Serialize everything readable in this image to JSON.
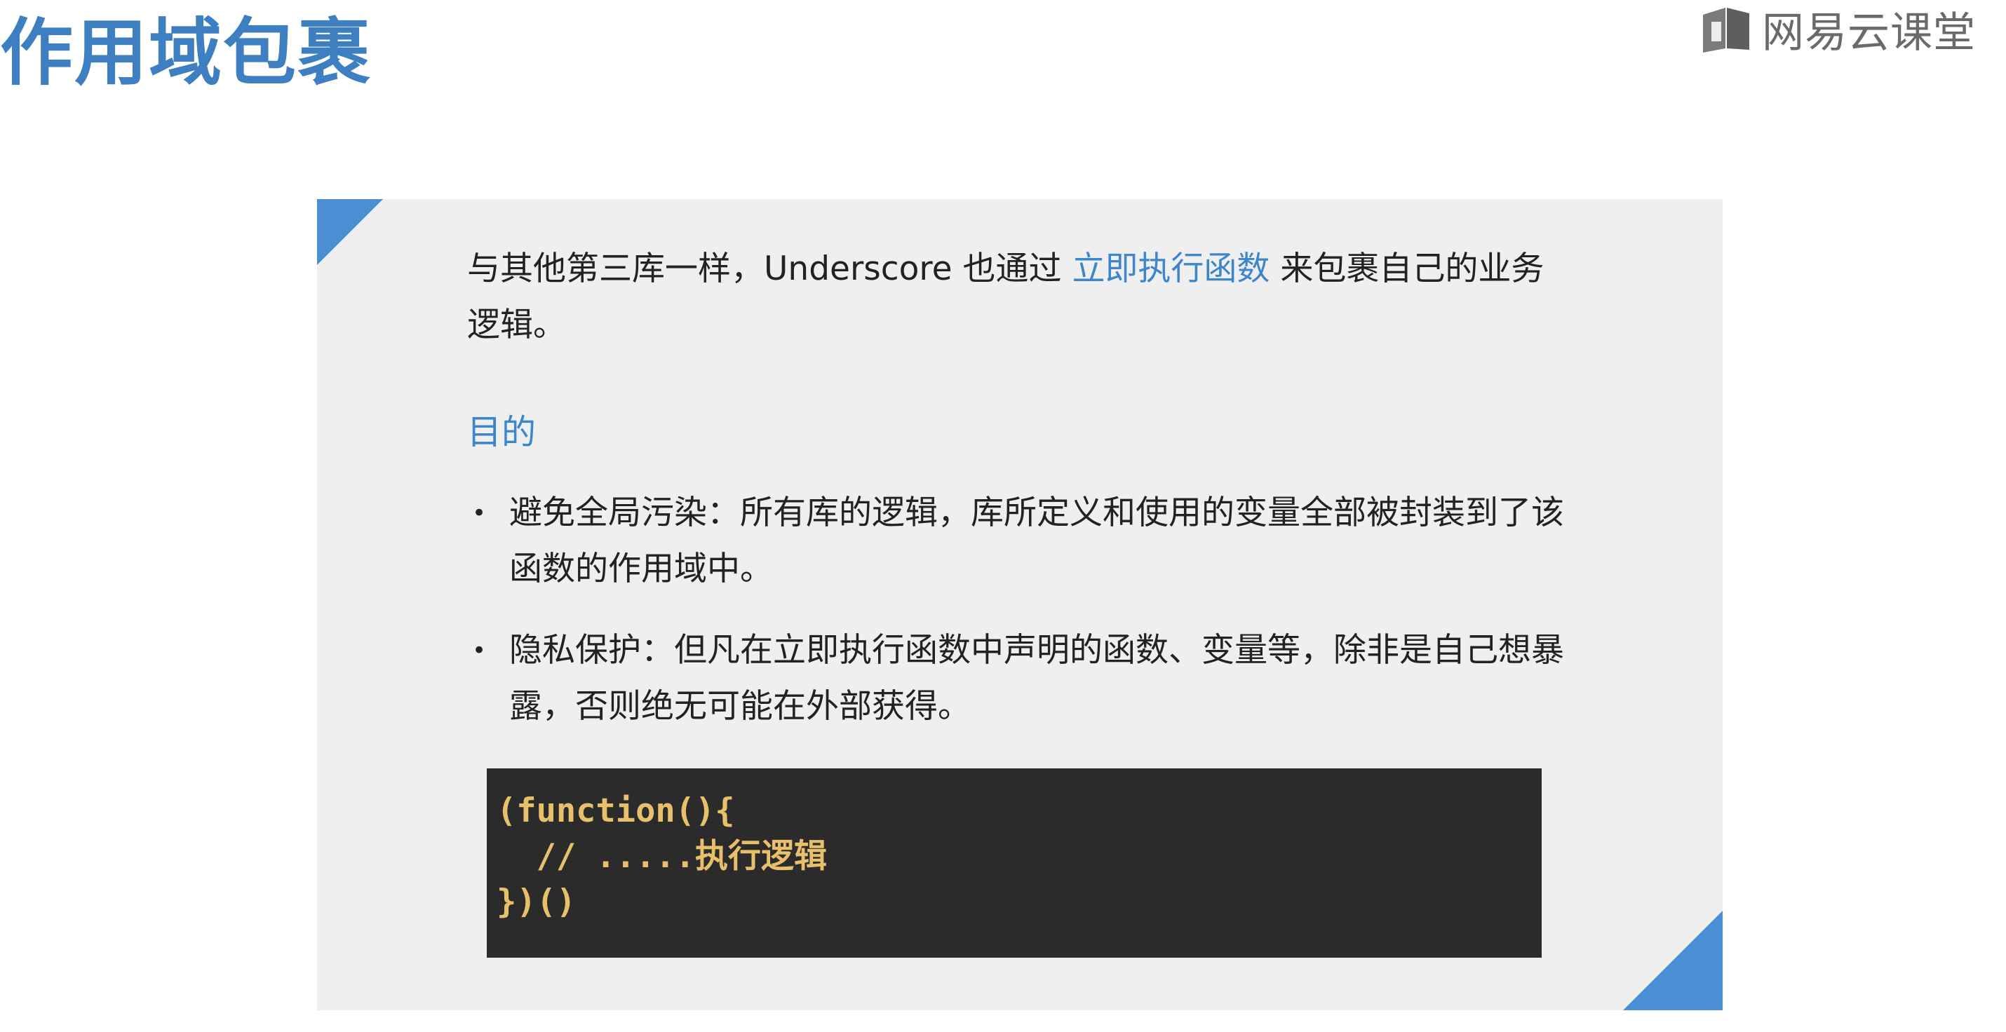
{
  "header": {
    "title": "作用域包裹",
    "brand_name": "网易云课堂",
    "brand_icon": "book-icon"
  },
  "slide": {
    "intro_before": "与其他第三库一样，Underscore 也通过 ",
    "intro_highlight": "立即执行函数",
    "intro_after": " 来包裹自己的业务逻辑。",
    "section_heading": "目的",
    "bullets": [
      "避免全局污染：所有库的逻辑，库所定义和使用的变量全部被封装到了该函数的作用域中。",
      "隐私保护：但凡在立即执行函数中声明的函数、变量等，除非是自己想暴露，否则绝无可能在外部获得。"
    ],
    "bullet_marker": "•",
    "code_lines": [
      "(function(){",
      "  // .....执行逻辑",
      "})()"
    ]
  },
  "colors": {
    "accent": "#3d7fc1",
    "highlight": "#3d86cc",
    "card_bg": "#efefef",
    "code_bg": "#2b2b2b",
    "code_text": "#e8bf6a"
  }
}
